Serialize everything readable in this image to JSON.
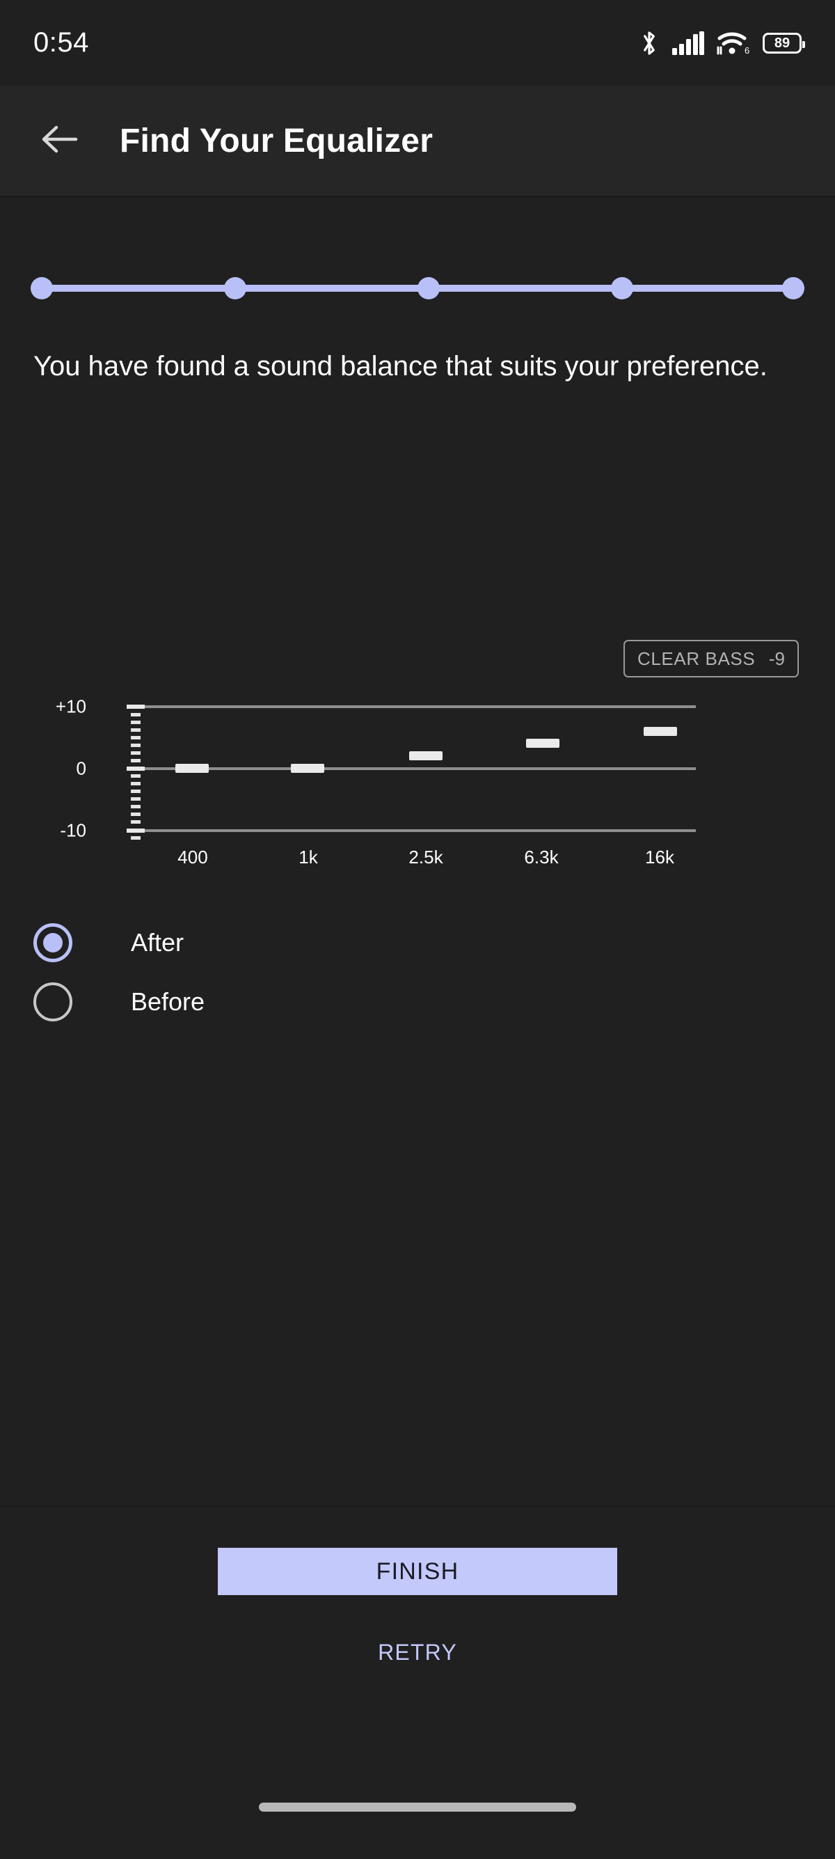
{
  "status_bar": {
    "clock": "0:54",
    "icons": [
      "bluetooth-icon",
      "cellular-signal-icon",
      "wifi-6-icon",
      "battery-icon"
    ],
    "battery_level": "89",
    "wifi_generation": "6"
  },
  "app_bar": {
    "back_icon": "arrow-left-icon",
    "title": "Find Your Equalizer"
  },
  "progress": {
    "steps": 5,
    "completed": 5,
    "color": "#b9c0f7"
  },
  "headline": "You have found a sound balance that suits your preference.",
  "clear_bass": {
    "label": "CLEAR BASS",
    "value": "-9"
  },
  "chart_data": {
    "type": "bar",
    "title": "",
    "categories": [
      "400",
      "1k",
      "2.5k",
      "6.3k",
      "16k"
    ],
    "values": [
      0,
      0,
      2,
      4,
      6
    ],
    "xlabel": "",
    "ylabel": "",
    "ylim": [
      -10,
      10
    ],
    "ytick_labels": [
      "+10",
      "0",
      "-10"
    ],
    "ytick_values": [
      10,
      0,
      -10
    ],
    "grid": true,
    "legend": "none",
    "bar_color": "#eaeaea",
    "axis_color": "#8f8f8f"
  },
  "options": {
    "selected": "After",
    "items": [
      {
        "label": "After",
        "selected": true
      },
      {
        "label": "Before",
        "selected": false
      }
    ]
  },
  "actions": {
    "finish_label": "FINISH",
    "retry_label": "RETRY",
    "finish_color": "#c3c9fb",
    "retry_color": "#c3c9fb"
  }
}
